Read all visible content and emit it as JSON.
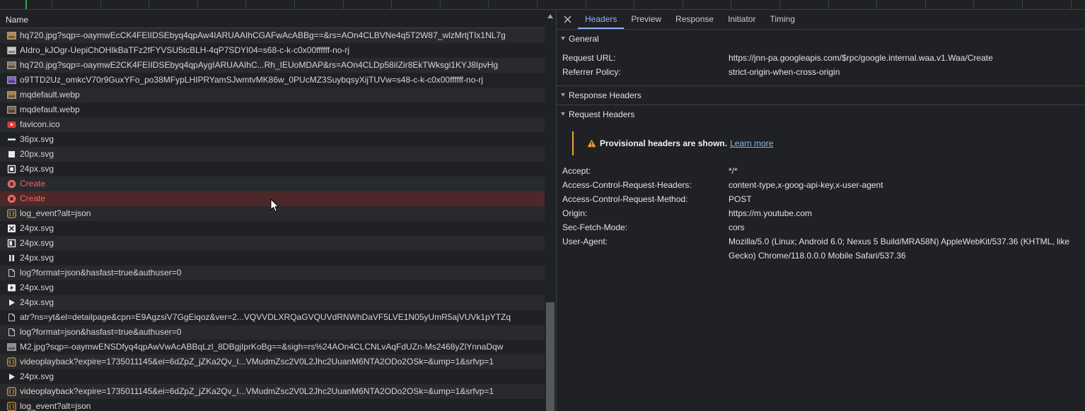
{
  "colors": {
    "background": "#202124",
    "row_alt": "#292a2d",
    "text": "#d6d6d6",
    "accent": "#8ab4f8",
    "error_text": "#ee675c",
    "selected_error_row": "#4c2828",
    "warning": "#e8a33d",
    "load_marker": "#34a853"
  },
  "requests": {
    "column_header": "Name",
    "rows": [
      {
        "name": "hq720.jpg?sqp=-oaymwEcCK4FEIIDSEbyq4qpAw4IARUAAIhCGAFwAcABBg==&rs=AOn4CLBVNe4q5T2W87_wlzMrtjTIx1NL7g",
        "icon": "image-thumbnail-icon",
        "thumb_color": "#b58b4c"
      },
      {
        "name": "AIdro_kJOgr-UepiChOHIkBaTFz2fFYVSU5tcBLH-4qP7SDYI04=s68-c-k-c0x00ffffff-no-rj",
        "icon": "image-thumbnail-icon",
        "thumb_color": "#c8c8c8"
      },
      {
        "name": "hq720.jpg?sqp=-oaymwE2CK4FEIIDSEbyq4qpAygIARUAAIhC...Rh_IEUoMDAP&rs=AOn4CLDp58iIZir8EkTWksgi1KYJ8IpvHg",
        "icon": "image-thumbnail-icon",
        "thumb_color": "#8a7a68"
      },
      {
        "name": "o9TTD2Uz_omkcV70r9GuxYFo_po38MFypLHIPRYamSJwmtvMK86w_0PUcMZ3SuybqsyXijTUVw=s48-c-k-c0x00ffffff-no-rj",
        "icon": "image-thumbnail-icon",
        "thumb_color": "#7d63b8"
      },
      {
        "name": "mqdefault.webp",
        "icon": "image-thumbnail-icon",
        "thumb_color": "#a5824f"
      },
      {
        "name": "mqdefault.webp",
        "icon": "image-thumbnail-icon",
        "thumb_color": "#7a6650"
      },
      {
        "name": "favicon.ico",
        "icon": "youtube-favicon-icon"
      },
      {
        "name": "36px.svg",
        "icon": "svg-dash-icon"
      },
      {
        "name": "20px.svg",
        "icon": "svg-square-icon"
      },
      {
        "name": "24px.svg",
        "icon": "svg-screen-icon"
      },
      {
        "name": "Create",
        "icon": "error-icon",
        "status": "error"
      },
      {
        "name": "Create",
        "icon": "error-icon",
        "status": "error",
        "selected": true
      },
      {
        "name": "log_event?alt=json",
        "icon": "fetch-icon"
      },
      {
        "name": "24px.svg",
        "icon": "svg-dice-icon"
      },
      {
        "name": "24px.svg",
        "icon": "svg-flag-icon"
      },
      {
        "name": "24px.svg",
        "icon": "svg-pause-icon"
      },
      {
        "name": "log?format=json&hasfast=true&authuser=0",
        "icon": "document-icon"
      },
      {
        "name": "24px.svg",
        "icon": "svg-play-box-icon"
      },
      {
        "name": "24px.svg",
        "icon": "svg-play-icon"
      },
      {
        "name": "atr?ns=yt&el=detailpage&cpn=E9AgzsiV7GgEiqoz&ver=2...VQVVDLXRQaGVQUVdRNWhDaVF5LVE1N05yUmR5ajVUVk1pYTZq",
        "icon": "document-icon"
      },
      {
        "name": "log?format=json&hasfast=true&authuser=0",
        "icon": "document-icon"
      },
      {
        "name": "M2.jpg?sqp=-oaymwENSDfyq4qpAwVwAcABBqLzl_8DBgjIprKoBg==&sigh=rs%24AOn4CLCNLvAqFdUZn-Ms2468yZlYnnaDqw",
        "icon": "image-thumbnail-icon",
        "thumb_color": "#8c8c8c"
      },
      {
        "name": "videoplayback?expire=1735011145&ei=6dZpZ_jZKa2Qv_I...VMudmZsc2V0L2Jhc2UuanM6NTA2ODo2OSk=&ump=1&srfvp=1",
        "icon": "fetch-icon"
      },
      {
        "name": "24px.svg",
        "icon": "svg-play-icon"
      },
      {
        "name": "videoplayback?expire=1735011145&ei=6dZpZ_jZKa2Qv_I...VMudmZsc2V0L2Jhc2UuanM6NTA2ODo2OSk=&ump=1&srfvp=1",
        "icon": "fetch-icon"
      },
      {
        "name": "log_event?alt=json",
        "icon": "fetch-icon"
      }
    ]
  },
  "details": {
    "close_icon": "close-icon",
    "tabs": [
      {
        "label": "Headers",
        "active": true
      },
      {
        "label": "Preview",
        "active": false
      },
      {
        "label": "Response",
        "active": false
      },
      {
        "label": "Initiator",
        "active": false
      },
      {
        "label": "Timing",
        "active": false
      }
    ],
    "general": {
      "title": "General",
      "fields": [
        {
          "name": "Request URL:",
          "value": "https://jnn-pa.googleapis.com/$rpc/google.internal.waa.v1.Waa/Create"
        },
        {
          "name": "Referrer Policy:",
          "value": "strict-origin-when-cross-origin"
        }
      ]
    },
    "response_headers": {
      "title": "Response Headers"
    },
    "request_headers": {
      "title": "Request Headers",
      "warning": {
        "icon": "warning-icon",
        "text": "Provisional headers are shown.",
        "link": "Learn more"
      },
      "fields": [
        {
          "name": "Accept:",
          "value": "*/*"
        },
        {
          "name": "Access-Control-Request-Headers:",
          "value": "content-type,x-goog-api-key,x-user-agent"
        },
        {
          "name": "Access-Control-Request-Method:",
          "value": "POST"
        },
        {
          "name": "Origin:",
          "value": "https://m.youtube.com"
        },
        {
          "name": "Sec-Fetch-Mode:",
          "value": "cors"
        },
        {
          "name": "User-Agent:",
          "value": "Mozilla/5.0 (Linux; Android 6.0; Nexus 5 Build/MRA58N) AppleWebKit/537.36 (KHTML, like Gecko) Chrome/118.0.0.0 Mobile Safari/537.36"
        }
      ]
    }
  }
}
